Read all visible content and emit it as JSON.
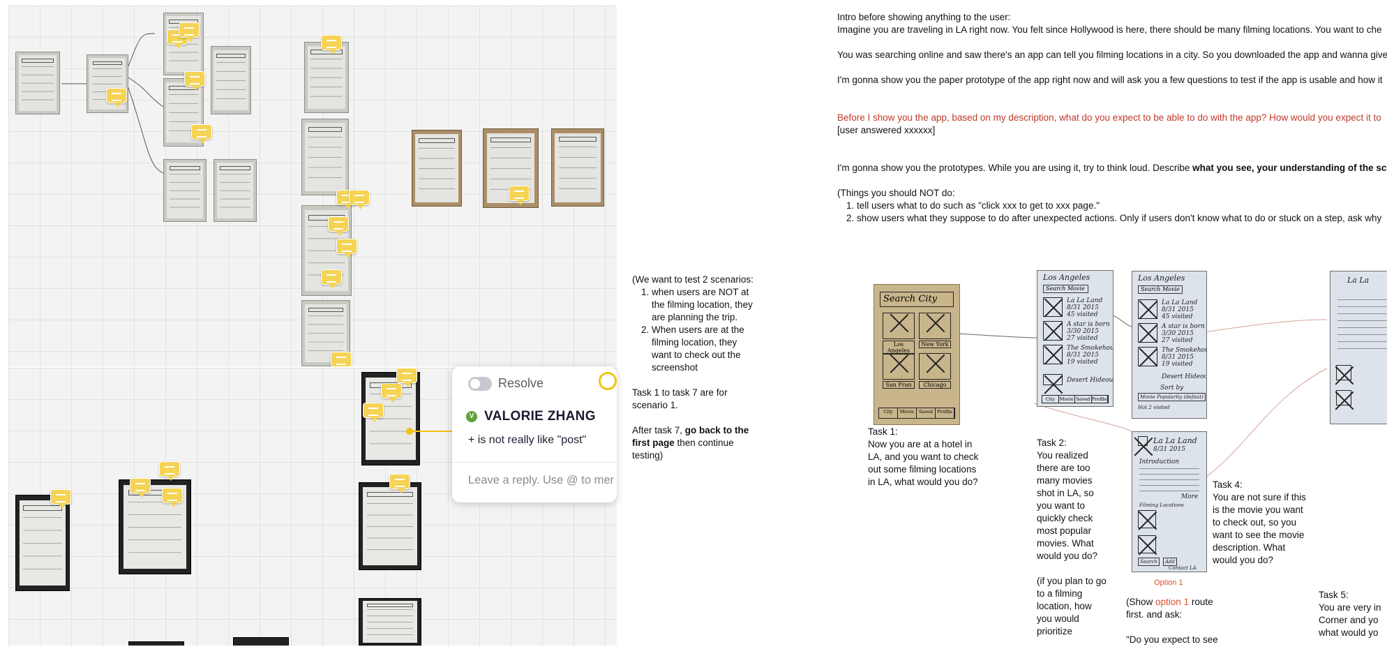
{
  "comment": {
    "resolve_label": "Resolve",
    "author_initial": "V",
    "author": "VALORIE ZHANG",
    "text": "+ is not really like \"post\"",
    "reply_placeholder": "Leave a reply. Use @ to mer"
  },
  "doc": {
    "intro_heading": "Intro before showing anything to the user:",
    "intro_line1": "Imagine you are traveling in LA right now. You felt since Hollywood is here, there should be many filming locations. You want to che",
    "intro_line2": "You was searching online and saw there's an app can tell you filming locations in a city. So you downloaded the app and wanna give",
    "intro_line3": "I'm gonna show you the paper prototype of the app right now and will ask you a few questions to test if the app is usable and how it",
    "question": "Before I show you the app, based on my description, what do you expect to be able to do with the app? How would you expect it to",
    "answered": "[user answered xxxxxx]",
    "think_loud_prefix": "I'm gonna show you the prototypes. While you are using it, try to think loud. Describe ",
    "think_loud_bold": "what you see, your understanding of the sc",
    "not_do_heading": "(Things you should NOT do:",
    "not_do_items": [
      "tell users what to do such as \"click xxx to get to xxx page.\"",
      "show users what they suppose to do after unexpected actions. Only if users don't know what to do or stuck on a step, ask why"
    ],
    "scenarios_heading": "(We want to test 2 scenarios:",
    "scenarios": [
      "when users are NOT at the filming location, they are planning the trip.",
      "When users are at the filming location, they want to check out the screenshot"
    ],
    "task_range": "Task 1 to task 7 are for scenario 1.",
    "after_prefix": "After task 7, ",
    "after_bold": "go back to the first page",
    "after_suffix": " then continue testing)",
    "task1_title": "Task 1:",
    "task1_body": "Now you are at a hotel in LA, and you want to check out some filming locations in LA, what would you do?",
    "task2_title": "Task 2:",
    "task2_body": "You realized there are too many movies shot in LA, so you want to quickly check most popular movies. What would you do?",
    "task2_note": "(if you plan to go to a filming location, how you would prioritize",
    "task4_title": "Task 4:",
    "task4_body": "You are not sure if this is the movie you want to check out, so you want to see the movie description. What would you do?",
    "option1_caption": "Option 1",
    "show_prefix": "(Show ",
    "show_option": "option 1",
    "show_suffix": " route first. and ask:",
    "expect_quote": "\"Do you expect to see",
    "task5_title": "Task 5:",
    "task5_body": "You are very in Corner and yo what would yo"
  },
  "sketches": {
    "search_city": {
      "title": "Search City",
      "cities": [
        "Los Angeles",
        "New York",
        "San Fran",
        "Chicago"
      ],
      "tabs": [
        "City",
        "Movie",
        "Saved",
        "Profile"
      ]
    },
    "la_list": {
      "title": "Los Angeles",
      "search": "Search Movie",
      "movies": [
        {
          "name": "La La Land",
          "date": "8/31 2015",
          "visits": "45 visited"
        },
        {
          "name": "A star is born",
          "date": "3/30 2015",
          "visits": "27 visited"
        },
        {
          "name": "The Smokehouse",
          "date": "8/31 2015",
          "visits": "19 visited"
        }
      ],
      "extra": "Desert Hideout",
      "tabs": [
        "City",
        "Movie",
        "Saved",
        "Profile"
      ]
    },
    "la_sorted": {
      "title": "Los Angeles",
      "search": "Search Movie",
      "movies": [
        {
          "name": "La La Land",
          "date": "8/31 2015",
          "visits": "45 visited"
        },
        {
          "name": "A star is born",
          "date": "3/30 2015",
          "visits": "27 visited"
        },
        {
          "name": "The Smokehouse",
          "date": "8/31 2015",
          "visits": "19 visited"
        },
        {
          "name": "Desert Hideout",
          "date": "",
          "visits": ""
        }
      ],
      "sort": "Sort by",
      "sort_value": "Movie Popularity (defaut)",
      "footer": "Hot 2 visited"
    },
    "lala_detail": {
      "title": "La La Land",
      "date": "8/31 2015",
      "intro": "Introduction",
      "more": "More",
      "scene": "Filming Locations",
      "buttons": [
        "Search",
        "Add"
      ],
      "footer": "Contact LA"
    },
    "right_edge": {
      "title": "La La"
    }
  },
  "colors": {
    "bubble": "#f5d355",
    "accent_ring": "#f1c40f",
    "link_red": "#c0392b",
    "option_orange": "#d9502b"
  }
}
